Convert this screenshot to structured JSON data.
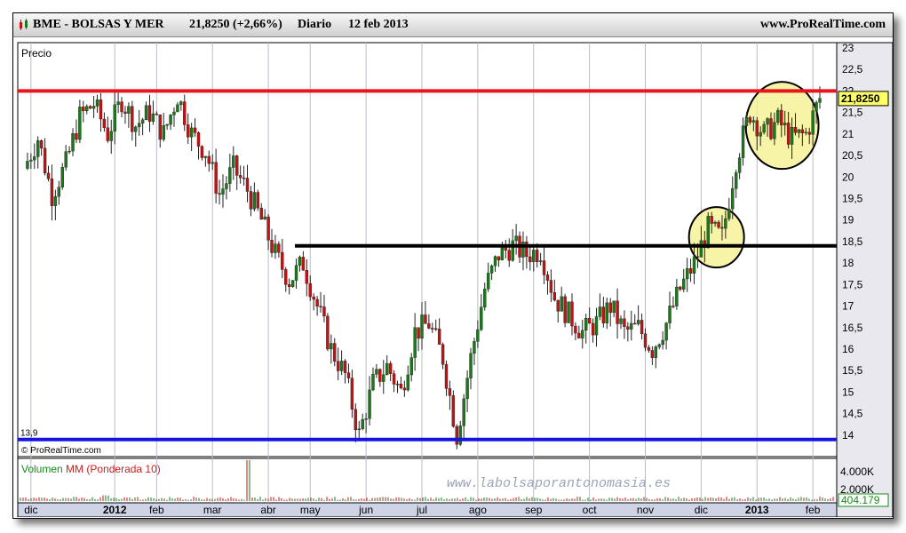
{
  "header": {
    "ticker": "BME - BOLSAS Y MER",
    "last_price": "21,8250",
    "change_pct": "(+2,66%)",
    "period": "Diario",
    "date": "12 feb 2013",
    "site": "www.ProRealTime.com"
  },
  "panel_labels": {
    "price": "Precio",
    "volume": "Volumen",
    "volume_ma": "MM (Ponderada 10)",
    "copyright": "© ProRealTime.com",
    "watermark": "www.labolsaporantonomasia.es",
    "support_label": "13,9"
  },
  "price_tag": "21,8250",
  "volume_tag": "404.179",
  "colors": {
    "resistance": "#e8141c",
    "mid_line": "#000000",
    "support": "#1515e0",
    "candle_up": "#1a7a1a",
    "candle_down": "#c81010",
    "highlight_fill": "#f5f08a",
    "volume_label": "#1a8a1a",
    "volume_ma_label": "#c82020"
  },
  "chart_data": {
    "type": "candlestick",
    "title": "BME - BOLSAS Y MER",
    "period": "Diario",
    "x_axis_labels": [
      "dic",
      "2012",
      "feb",
      "mar",
      "abr",
      "may",
      "jun",
      "jul",
      "ago",
      "sep",
      "oct",
      "nov",
      "dic",
      "2013",
      "feb"
    ],
    "y_axis": {
      "min": 13.75,
      "max": 23,
      "ticks": [
        "23",
        "22,5",
        "22",
        "21,5",
        "21",
        "20,5",
        "20",
        "19,5",
        "19",
        "18,5",
        "18",
        "17,5",
        "17",
        "16,5",
        "16",
        "15,5",
        "15",
        "14,5",
        "14"
      ]
    },
    "horizontal_lines": [
      {
        "role": "resistance",
        "value": 22.0,
        "from_label": "dic (2011)",
        "to_label": "feb (2013)"
      },
      {
        "role": "neckline",
        "value": 18.4,
        "from_label": "may",
        "to_label": "feb (2013)"
      },
      {
        "role": "support",
        "value": 13.9,
        "from_label": "dic (2011)",
        "to_label": "feb (2013)"
      }
    ],
    "highlights": [
      {
        "shape": "circle",
        "around": "breakout through 18,4 in dic 2012",
        "center_value": 18.6
      },
      {
        "shape": "circle",
        "around": "consolidation near 22 in ene-feb 2013",
        "center_value": 21.2
      }
    ],
    "close_series": [
      {
        "label": "dic (2011)",
        "value": 20.2
      },
      {
        "label": "",
        "value": 20.9
      },
      {
        "label": "",
        "value": 19.6
      },
      {
        "label": "",
        "value": 20.3
      },
      {
        "label": "",
        "value": 21.4
      },
      {
        "label": "",
        "value": 21.7
      },
      {
        "label": "2012",
        "value": 21.0
      },
      {
        "label": "",
        "value": 21.8
      },
      {
        "label": "",
        "value": 21.2
      },
      {
        "label": "feb",
        "value": 21.5
      },
      {
        "label": "",
        "value": 21.0
      },
      {
        "label": "",
        "value": 21.9
      },
      {
        "label": "",
        "value": 21.0
      },
      {
        "label": "mar",
        "value": 20.6
      },
      {
        "label": "",
        "value": 19.6
      },
      {
        "label": "",
        "value": 20.2
      },
      {
        "label": "",
        "value": 19.7
      },
      {
        "label": "abr",
        "value": 19.0
      },
      {
        "label": "",
        "value": 18.2
      },
      {
        "label": "",
        "value": 17.6
      },
      {
        "label": "may",
        "value": 18.0
      },
      {
        "label": "",
        "value": 17.0
      },
      {
        "label": "",
        "value": 16.0
      },
      {
        "label": "",
        "value": 15.4
      },
      {
        "label": "jun",
        "value": 14.0
      },
      {
        "label": "",
        "value": 15.2
      },
      {
        "label": "",
        "value": 15.6
      },
      {
        "label": "",
        "value": 15.0
      },
      {
        "label": "jul",
        "value": 16.4
      },
      {
        "label": "",
        "value": 16.6
      },
      {
        "label": "",
        "value": 15.8
      },
      {
        "label": "",
        "value": 14.0
      },
      {
        "label": "ago",
        "value": 15.8
      },
      {
        "label": "",
        "value": 17.4
      },
      {
        "label": "",
        "value": 18.2
      },
      {
        "label": "",
        "value": 18.4
      },
      {
        "label": "sep",
        "value": 18.2
      },
      {
        "label": "",
        "value": 18.3
      },
      {
        "label": "",
        "value": 17.2
      },
      {
        "label": "",
        "value": 16.8
      },
      {
        "label": "oct",
        "value": 16.4
      },
      {
        "label": "",
        "value": 16.6
      },
      {
        "label": "",
        "value": 17.0
      },
      {
        "label": "",
        "value": 16.4
      },
      {
        "label": "nov",
        "value": 16.5
      },
      {
        "label": "",
        "value": 16.0
      },
      {
        "label": "",
        "value": 16.6
      },
      {
        "label": "",
        "value": 17.4
      },
      {
        "label": "dic",
        "value": 18.0
      },
      {
        "label": "",
        "value": 18.8
      },
      {
        "label": "",
        "value": 18.6
      },
      {
        "label": "",
        "value": 20.4
      },
      {
        "label": "2013",
        "value": 21.5
      },
      {
        "label": "",
        "value": 21.0
      },
      {
        "label": "",
        "value": 21.3
      },
      {
        "label": "",
        "value": 20.9
      },
      {
        "label": "feb",
        "value": 21.0
      },
      {
        "label": "12 feb 2013",
        "value": 21.825
      }
    ],
    "volume": {
      "label": "Volumen",
      "overlay": "MM (Ponderada 10)",
      "y_axis": {
        "min": 0,
        "max": 4000000,
        "ticks": [
          "4.000K",
          "2.000K"
        ]
      },
      "last_value": 404179
    }
  }
}
